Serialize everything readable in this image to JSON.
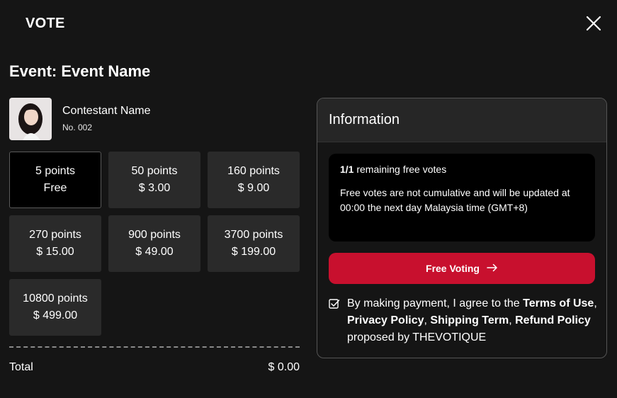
{
  "header": {
    "title": "VOTE"
  },
  "event": {
    "label": "Event: Event Name"
  },
  "contestant": {
    "name": "Contestant Name",
    "number": "No. 002"
  },
  "packages": [
    {
      "points": "5 points",
      "price": "Free",
      "selected": true
    },
    {
      "points": "50 points",
      "price": "$ 3.00"
    },
    {
      "points": "160 points",
      "price": "$ 9.00"
    },
    {
      "points": "270 points",
      "price": "$ 15.00"
    },
    {
      "points": "900 points",
      "price": "$ 49.00"
    },
    {
      "points": "3700 points",
      "price": "$ 199.00"
    },
    {
      "points": "10800 points",
      "price": "$ 499.00"
    }
  ],
  "total": {
    "label": "Total",
    "value": "$ 0.00"
  },
  "info": {
    "title": "Information",
    "remaining_count": "1/1",
    "remaining_text": " remaining free votes",
    "note": "Free votes are not cumulative and will be updated at 00:00 the next day Malaysia time (GMT+8)",
    "button_label": "Free Voting",
    "agree": {
      "prefix": "By making payment, I agree to the ",
      "terms": "Terms of Use",
      "sep1": ", ",
      "privacy": "Privacy Policy",
      "sep2": ", ",
      "shipping": "Shipping Term",
      "sep3": ", ",
      "refund": "Refund Policy",
      "suffix": " proposed by THEVOTIQUE"
    }
  },
  "colors": {
    "accent": "#c8102e",
    "background": "#151515",
    "card": "#2a2a2a"
  }
}
